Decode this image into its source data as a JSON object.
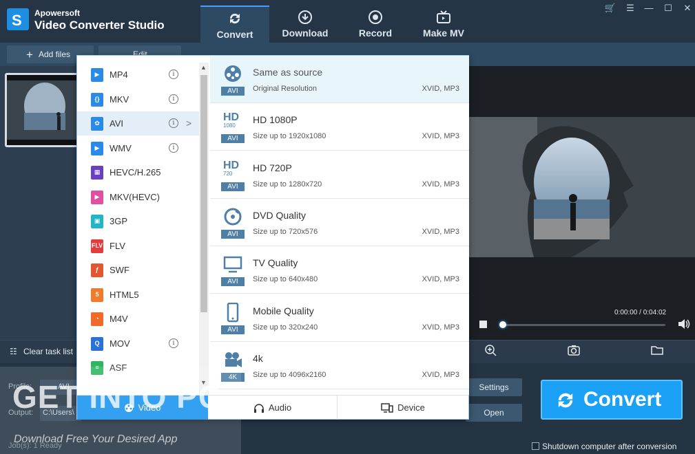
{
  "app": {
    "brand": "Apowersoft",
    "title": "Video Converter Studio"
  },
  "main_tabs": [
    {
      "label": "Convert",
      "icon": "convert-icon",
      "active": true
    },
    {
      "label": "Download",
      "icon": "download-icon"
    },
    {
      "label": "Record",
      "icon": "record-icon"
    },
    {
      "label": "Make MV",
      "icon": "tv-icon"
    }
  ],
  "toolbar": {
    "add_files": "Add files",
    "edit": "Edit"
  },
  "formats": [
    {
      "name": "MP4",
      "color": "#2a8be6",
      "glyph": "▶",
      "info": true
    },
    {
      "name": "MKV",
      "color": "#2a8be6",
      "glyph": "{}",
      "info": true
    },
    {
      "name": "AVI",
      "color": "#2a8be6",
      "glyph": "✿",
      "info": true,
      "selected": true
    },
    {
      "name": "WMV",
      "color": "#2a8be6",
      "glyph": "▶",
      "info": true
    },
    {
      "name": "HEVC/H.265",
      "color": "#6a3fc0",
      "glyph": "▦"
    },
    {
      "name": "MKV(HEVC)",
      "color": "#e04fa0",
      "glyph": "▶"
    },
    {
      "name": "3GP",
      "color": "#22b5c7",
      "glyph": "▣"
    },
    {
      "name": "FLV",
      "color": "#e23c3c",
      "glyph": "FLV"
    },
    {
      "name": "SWF",
      "color": "#e2572f",
      "glyph": "ƒ"
    },
    {
      "name": "HTML5",
      "color": "#f07b2a",
      "glyph": "5"
    },
    {
      "name": "M4V",
      "color": "#f06b2a",
      "glyph": "◔"
    },
    {
      "name": "MOV",
      "color": "#2a72d6",
      "glyph": "Q",
      "info": true
    },
    {
      "name": "ASF",
      "color": "#2db560",
      "glyph": "≡"
    }
  ],
  "presets": [
    {
      "name": "Same as source",
      "desc": "Original Resolution",
      "codec": "XVID, MP3",
      "badge": "AVI",
      "icon": "film-reel-icon",
      "selected": true
    },
    {
      "name": "HD 1080P",
      "desc": "Size up to 1920x1080",
      "codec": "XVID, MP3",
      "badge": "AVI",
      "hd": "HD",
      "res": "1080"
    },
    {
      "name": "HD 720P",
      "desc": "Size up to 1280x720",
      "codec": "XVID, MP3",
      "badge": "AVI",
      "hd": "HD",
      "res": "720"
    },
    {
      "name": "DVD Quality",
      "desc": "Size up to 720x576",
      "codec": "XVID, MP3",
      "badge": "AVI",
      "icon": "disc-icon"
    },
    {
      "name": "TV Quality",
      "desc": "Size up to 640x480",
      "codec": "XVID, MP3",
      "badge": "AVI",
      "icon": "monitor-icon"
    },
    {
      "name": "Mobile Quality",
      "desc": "Size up to 320x240",
      "codec": "XVID, MP3",
      "badge": "AVI",
      "icon": "phone-icon"
    },
    {
      "name": "4k",
      "desc": "Size up to 4096x2160",
      "codec": "XVID, MP3",
      "badge": "4K",
      "icon": "camera-icon"
    }
  ],
  "categories": [
    {
      "label": "Video",
      "icon": "film-reel-icon",
      "active": true
    },
    {
      "label": "Audio",
      "icon": "headphones-icon"
    },
    {
      "label": "Device",
      "icon": "device-icon"
    }
  ],
  "player": {
    "time": "0:00:00 / 0:04:02",
    "progress": 0
  },
  "task": {
    "clear_label": "Clear task list"
  },
  "bottom": {
    "profile_label": "Profile:",
    "profile_value": "AVI",
    "output_label": "Output:",
    "output_value": "C:\\Users\\",
    "settings_label": "Settings",
    "open_label": "Open",
    "convert_label": "Convert",
    "shutdown_label": "Shutdown computer after conversion",
    "job_status": "Job(s): 1     Ready"
  },
  "watermark": {
    "main": "GET INTO PC",
    "sub": "Download Free Your Desired App"
  }
}
